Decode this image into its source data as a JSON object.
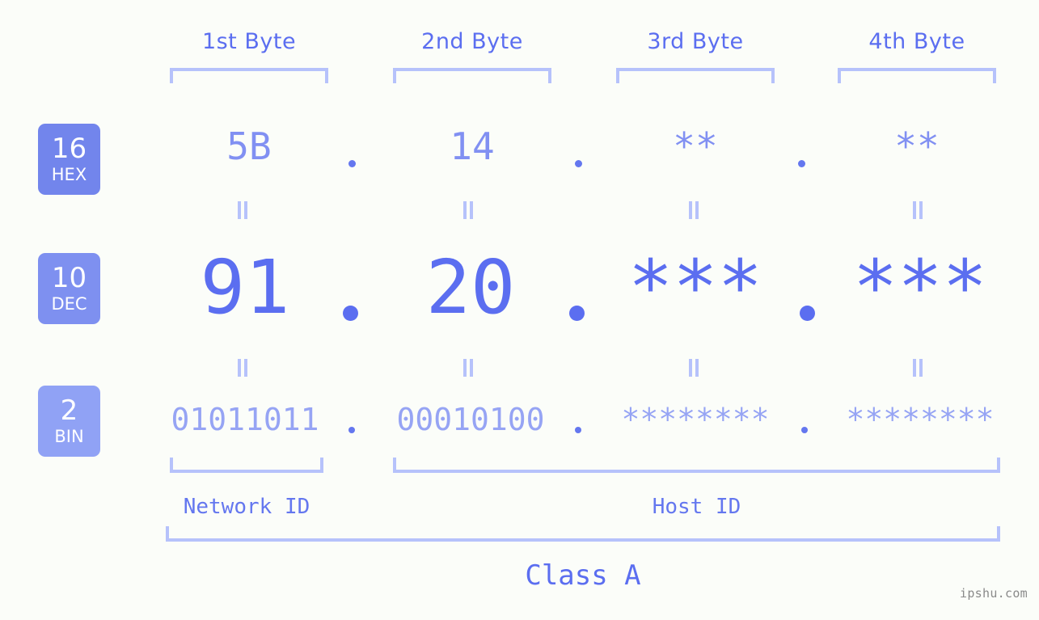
{
  "background_color": "#fbfdf9",
  "accent_color": "#5b6ef0",
  "bracket_color": "#b6c2fb",
  "headers": {
    "byte1": "1st Byte",
    "byte2": "2nd Byte",
    "byte3": "3rd Byte",
    "byte4": "4th Byte"
  },
  "bases": [
    {
      "number": "16",
      "name": "HEX",
      "color": "#7285ec"
    },
    {
      "number": "10",
      "name": "DEC",
      "color": "#7e90f0"
    },
    {
      "number": "2",
      "name": "BIN",
      "color": "#90a2f5"
    }
  ],
  "rows": {
    "hex": {
      "base_number": "16",
      "base_name": "HEX",
      "values": [
        "5B",
        "14",
        "**",
        "**"
      ],
      "separator": "."
    },
    "dec": {
      "base_number": "10",
      "base_name": "DEC",
      "values": [
        "91",
        "20",
        "***",
        "***"
      ],
      "separator": "."
    },
    "bin": {
      "base_number": "2",
      "base_name": "BIN",
      "values": [
        "01011011",
        "00010100",
        "********",
        "********"
      ],
      "separator": "."
    }
  },
  "equals_sign": "=",
  "sections": {
    "network_id": "Network ID",
    "host_id": "Host ID",
    "class": "Class A"
  },
  "watermark": "ipshu.com"
}
